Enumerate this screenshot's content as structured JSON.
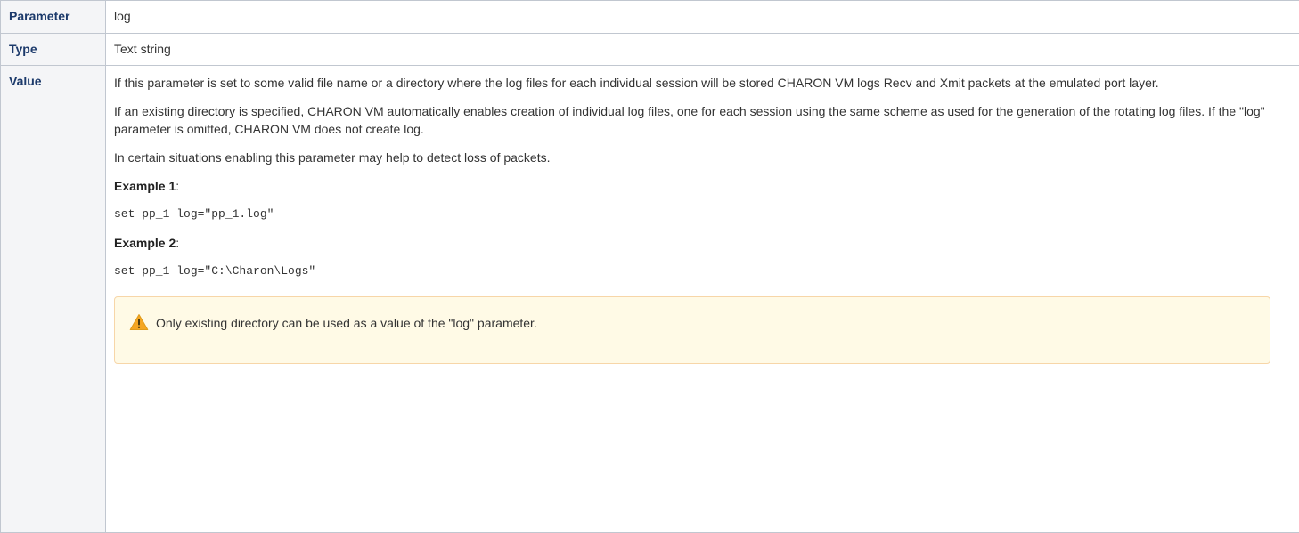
{
  "table": {
    "rows": [
      {
        "header": "Parameter",
        "value": "log"
      },
      {
        "header": "Type",
        "value": "Text string"
      },
      {
        "header": "Value"
      }
    ]
  },
  "value_section": {
    "paragraph1": "If this parameter is set to some valid file name or a directory where the log files for each individual session will be stored CHARON VM logs Recv and Xmit packets at the emulated port layer.",
    "paragraph2": "If an existing directory is specified, CHARON VM automatically enables creation of individual log files, one for each session using the same scheme as used for the generation of the rotating log files. If the \"log\" parameter is omitted, CHARON VM does not create log.",
    "paragraph3": "In certain situations enabling this parameter may help to detect loss of packets.",
    "example1_label": "Example 1",
    "example1_colon": ":",
    "example1_code": "set pp_1 log=\"pp_1.log\"",
    "example2_label": "Example 2",
    "example2_colon": ":",
    "example2_code": "set pp_1 log=\"C:\\Charon\\Logs\"",
    "warning": {
      "icon": "warning-icon",
      "text": "Only existing directory can be used as a value of the \"log\" parameter."
    }
  },
  "colors": {
    "header_bg": "#f4f5f7",
    "header_text": "#1c3a6b",
    "border": "#c1c7d0",
    "warning_bg": "#fffae6",
    "warning_border": "#f7d6a8",
    "warning_icon": "#f5a623"
  }
}
